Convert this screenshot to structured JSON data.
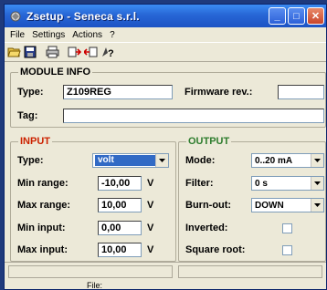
{
  "window": {
    "title": "Zsetup - Seneca s.r.l."
  },
  "menu": {
    "file": "File",
    "settings": "Settings",
    "actions": "Actions",
    "help": "?"
  },
  "toolbar": {
    "icons": [
      "open-icon",
      "save-icon",
      "print-icon",
      "read-icon",
      "write-icon",
      "help-icon"
    ]
  },
  "module_info": {
    "title": "MODULE INFO",
    "type_label": "Type:",
    "type_value": "Z109REG",
    "firmware_label": "Firmware rev.:",
    "firmware_value": "",
    "tag_label": "Tag:",
    "tag_value": ""
  },
  "input": {
    "title": "INPUT",
    "type_label": "Type:",
    "type_value": "volt",
    "min_range_label": "Min range:",
    "min_range_value": "-10,00",
    "max_range_label": "Max range:",
    "max_range_value": "10,00",
    "min_input_label": "Min input:",
    "min_input_value": "0,00",
    "max_input_label": "Max input:",
    "max_input_value": "10,00",
    "unit": "V"
  },
  "output": {
    "title": "OUTPUT",
    "mode_label": "Mode:",
    "mode_value": "0..20 mA",
    "filter_label": "Filter:",
    "filter_value": "0 s",
    "burnout_label": "Burn-out:",
    "burnout_value": "DOWN",
    "inverted_label": "Inverted:",
    "square_root_label": "Square root:"
  },
  "status": {
    "file_label": "File:"
  },
  "colors": {
    "title_bar": "#2766d6",
    "input_title": "#cc2200",
    "output_title": "#2e7d2e",
    "module_info_title": "#000000"
  }
}
